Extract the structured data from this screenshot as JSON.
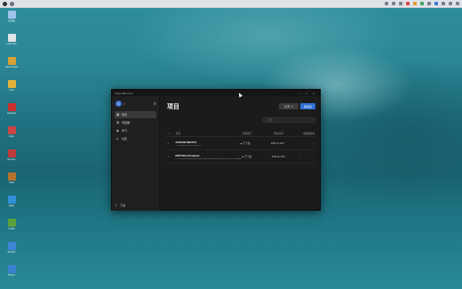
{
  "window": {
    "title": "Unity Hub 3.4.1",
    "minimize": "—",
    "maximize": "□",
    "close": "✕"
  },
  "sidebar": {
    "avatar_letter": "G",
    "items": [
      {
        "label": "项目",
        "icon": "cube-icon",
        "glyph": "▣"
      },
      {
        "label": "安装器",
        "icon": "lock-icon",
        "glyph": "▤"
      },
      {
        "label": "学习",
        "icon": "graduation-icon",
        "glyph": "◆"
      },
      {
        "label": "社区",
        "icon": "people-icon",
        "glyph": "●"
      }
    ],
    "downloads_label": "下载"
  },
  "main": {
    "title": "项目",
    "open_label": "打开",
    "new_label": "新项目",
    "search_placeholder": "搜索",
    "columns": {
      "name": "名称",
      "cloud": "云端项目",
      "modified": "修改时间",
      "version": "编辑器版本"
    },
    "projects": [
      {
        "name": "20230301MRTK3",
        "path": "D:\\Projects\\20230301MRTK3",
        "cloud": "已下载",
        "modified": "2023 2L.AF3",
        "version": "",
        "more": "···"
      },
      {
        "name": "MRTKDevTemplate",
        "path": "D:\\Projects\\MixedRealityToolkit-Unity-main\\UnityProjects\\MRTKDevTemplate",
        "cloud": "已下载",
        "modified": "2023 2L.AF3",
        "version": "",
        "more": "···"
      }
    ]
  },
  "desktop": {
    "icons": [
      {
        "label": "此电脑",
        "color": "#9fc4e8"
      },
      {
        "label": "Unity Hub",
        "color": "#dfe3e6"
      },
      {
        "label": "Visual Studio",
        "color": "#d8a13a"
      },
      {
        "label": "Unity",
        "color": "#e0b13b"
      },
      {
        "label": "OneNote",
        "color": "#c9332c"
      },
      {
        "label": "Apps",
        "color": "#c94545"
      },
      {
        "label": "Recycle",
        "color": "#c23a3a"
      },
      {
        "label": "Tools",
        "color": "#b6732c"
      },
      {
        "label": "Edge",
        "color": "#2f8fd8"
      },
      {
        "label": "Nvidia",
        "color": "#5aa23a"
      },
      {
        "label": "Settings",
        "color": "#3e86d8"
      },
      {
        "label": "Photos",
        "color": "#3b7fd0"
      }
    ]
  }
}
